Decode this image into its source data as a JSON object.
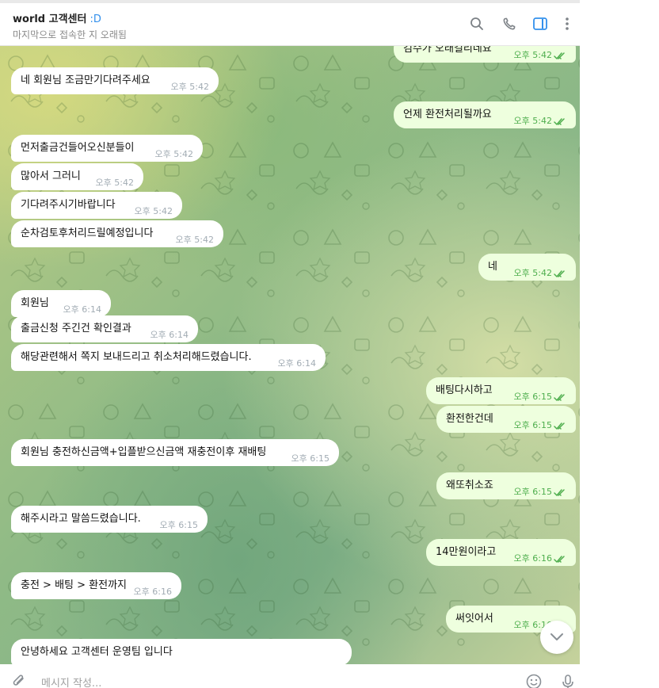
{
  "header": {
    "title": "world 고객센터",
    "title_emoji": ":D",
    "status": "마지막으로 접속한 지 오래됨",
    "icons": [
      "search-icon",
      "phone-icon",
      "sidebar-toggle-icon",
      "more-vertical-icon"
    ]
  },
  "messages": [
    {
      "dir": "out",
      "text": "검수가 오래걸리네요",
      "time": "오후 5:42"
    },
    {
      "dir": "in",
      "text": "네 회원님 조금만기다려주세요",
      "time": "오후 5:42"
    },
    {
      "dir": "out",
      "text": "언제 환전처리될까요",
      "time": "오후 5:42"
    },
    {
      "dir": "in",
      "text": "먼저출금건들어오신분들이",
      "time": "오후 5:42"
    },
    {
      "dir": "in",
      "text": "많아서 그러니",
      "time": "오후 5:42"
    },
    {
      "dir": "in",
      "text": "기다려주시기바랍니다",
      "time": "오후 5:42"
    },
    {
      "dir": "in",
      "text": "순차검토후처리드릴예정입니다",
      "time": "오후 5:42"
    },
    {
      "dir": "out",
      "text": "네",
      "time": "오후 5:42"
    },
    {
      "dir": "in",
      "text": "회원님",
      "time": "오후 6:14"
    },
    {
      "dir": "in",
      "text": "출금신청 주긴건 확인결과",
      "time": "오후 6:14"
    },
    {
      "dir": "in",
      "text": "해당관련해서 쪽지 보내드리고 취소처리해드렸습니다.",
      "time": "오후 6:14"
    },
    {
      "dir": "out",
      "text": "배팅다시하고",
      "time": "오후 6:15"
    },
    {
      "dir": "out",
      "text": "환전한건데",
      "time": "오후 6:15"
    },
    {
      "dir": "in",
      "text": "회원님 충전하신금액+입플받으신금액 재충전이후 재배팅",
      "time": "오후 6:15"
    },
    {
      "dir": "out",
      "text": "왜또취소죠",
      "time": "오후 6:15"
    },
    {
      "dir": "in",
      "text": "해주시라고 말씀드렸습니다.",
      "time": "오후 6:15"
    },
    {
      "dir": "out",
      "text": "14만원이라고",
      "time": "오후 6:16"
    },
    {
      "dir": "in",
      "text": "충전 > 배팅 > 환전까지",
      "time": "오후 6:16"
    },
    {
      "dir": "out",
      "text": "써잇어서",
      "time": "오후 6:16"
    },
    {
      "dir": "in",
      "text": "안녕하세요 고객센터 운영팀 입니다",
      "time": ""
    }
  ],
  "composer": {
    "placeholder": "메시지 작성...",
    "icons": [
      "attach-icon",
      "emoji-icon",
      "microphone-icon"
    ]
  },
  "scroll_button_icon": "chevron-down-icon",
  "colors": {
    "incoming_bubble": "#ffffff",
    "outgoing_bubble": "#eeffde",
    "outgoing_time": "#4fae4e",
    "accent": "#3390ec"
  }
}
